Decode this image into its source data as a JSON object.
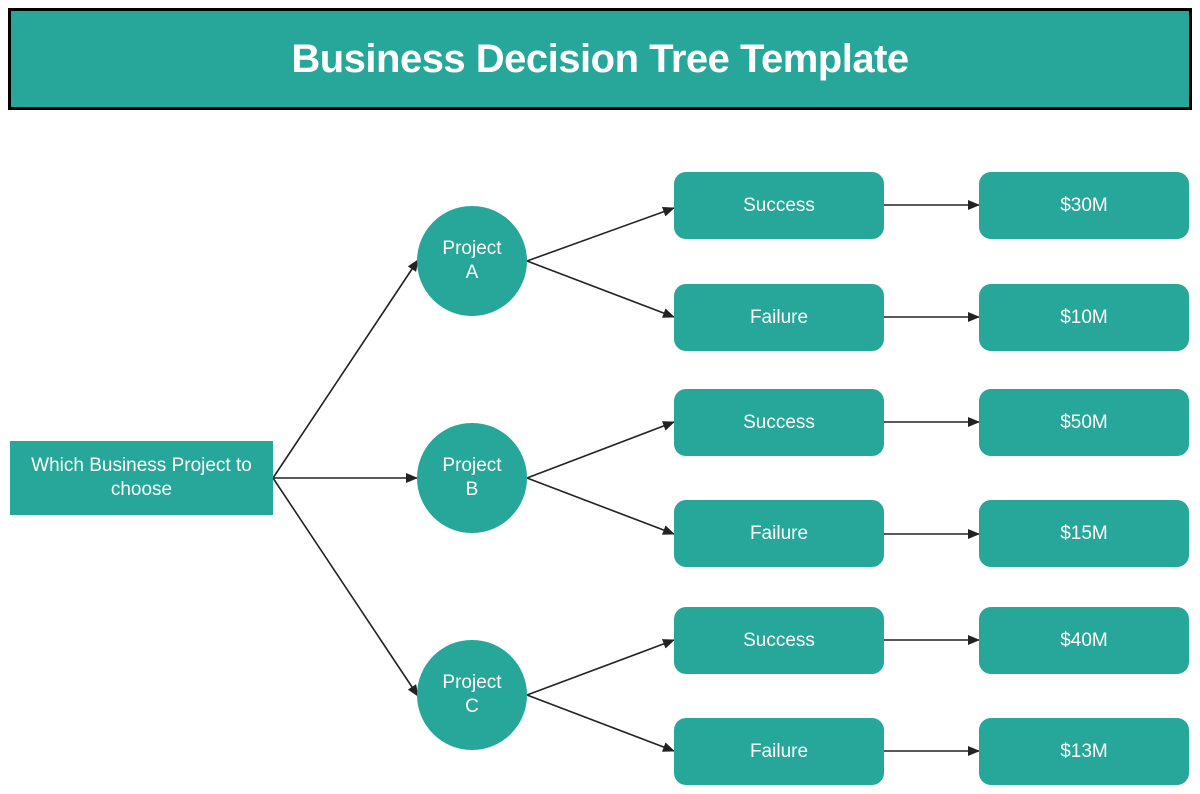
{
  "title": "Business Decision Tree Template",
  "colors": {
    "node_fill": "#27a69a",
    "node_text": "#ffffff",
    "edge": "#222222",
    "title_border": "#000000"
  },
  "root": {
    "label_line1": "Which Business Project to",
    "label_line2": "choose"
  },
  "projects": [
    {
      "line1": "Project",
      "line2": "A",
      "outcomes": [
        {
          "label": "Success",
          "value": "$30M"
        },
        {
          "label": "Failure",
          "value": "$10M"
        }
      ]
    },
    {
      "line1": "Project",
      "line2": "B",
      "outcomes": [
        {
          "label": "Success",
          "value": "$50M"
        },
        {
          "label": "Failure",
          "value": "$15M"
        }
      ]
    },
    {
      "line1": "Project",
      "line2": "C",
      "outcomes": [
        {
          "label": "Success",
          "value": "$40M"
        },
        {
          "label": "Failure",
          "value": "$13M"
        }
      ]
    }
  ]
}
